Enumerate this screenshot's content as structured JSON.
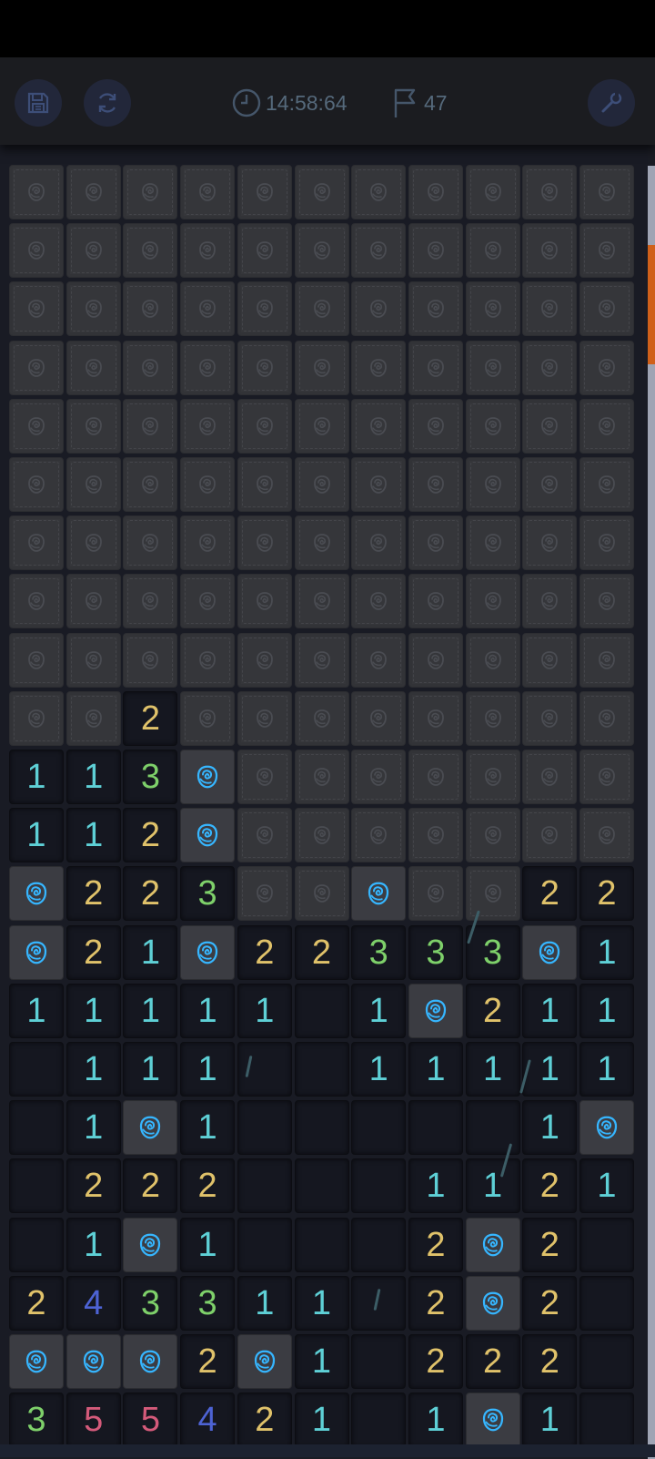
{
  "toolbar": {
    "timer": "14:58:64",
    "flags_remaining": "47",
    "icons": [
      "floppy-disk-icon",
      "refresh-icon",
      "clock-icon",
      "flag-icon",
      "wrench-icon"
    ]
  },
  "colors": {
    "1": "#5ed0d6",
    "2": "#e0c26a",
    "3": "#7ed06a",
    "4": "#4d63d4",
    "5": "#d45a7a",
    "rose_covered": "#4a4c52",
    "rose_flag": "#36b6ff"
  },
  "legend": {
    "C": "covered tile",
    "F": "flagged tile (rose)",
    "E": "revealed empty",
    "digit": "revealed number"
  },
  "board": {
    "cols": 11,
    "rows": [
      [
        "C",
        "C",
        "C",
        "C",
        "C",
        "C",
        "C",
        "C",
        "C",
        "C",
        "C"
      ],
      [
        "C",
        "C",
        "C",
        "C",
        "C",
        "C",
        "C",
        "C",
        "C",
        "C",
        "C"
      ],
      [
        "C",
        "C",
        "C",
        "C",
        "C",
        "C",
        "C",
        "C",
        "C",
        "C",
        "C"
      ],
      [
        "C",
        "C",
        "C",
        "C",
        "C",
        "C",
        "C",
        "C",
        "C",
        "C",
        "C"
      ],
      [
        "C",
        "C",
        "C",
        "C",
        "C",
        "C",
        "C",
        "C",
        "C",
        "C",
        "C"
      ],
      [
        "C",
        "C",
        "C",
        "C",
        "C",
        "C",
        "C",
        "C",
        "C",
        "C",
        "C"
      ],
      [
        "C",
        "C",
        "C",
        "C",
        "C",
        "C",
        "C",
        "C",
        "C",
        "C",
        "C"
      ],
      [
        "C",
        "C",
        "C",
        "C",
        "C",
        "C",
        "C",
        "C",
        "C",
        "C",
        "C"
      ],
      [
        "C",
        "C",
        "C",
        "C",
        "C",
        "C",
        "C",
        "C",
        "C",
        "C",
        "C"
      ],
      [
        "C",
        "C",
        "2",
        "C",
        "C",
        "C",
        "C",
        "C",
        "C",
        "C",
        "C"
      ],
      [
        "1",
        "1",
        "3",
        "F",
        "C",
        "C",
        "C",
        "C",
        "C",
        "C",
        "C"
      ],
      [
        "1",
        "1",
        "2",
        "F",
        "C",
        "C",
        "C",
        "C",
        "C",
        "C",
        "C"
      ],
      [
        "F",
        "2",
        "2",
        "3",
        "C",
        "C",
        "F",
        "C",
        "C",
        "2",
        "2"
      ],
      [
        "F",
        "2",
        "1",
        "F",
        "2",
        "2",
        "3",
        "3",
        "3",
        "F",
        "1"
      ],
      [
        "1",
        "1",
        "1",
        "1",
        "1",
        "E",
        "1",
        "F",
        "2",
        "1",
        "1"
      ],
      [
        "E",
        "1",
        "1",
        "1",
        "E",
        "E",
        "1",
        "1",
        "1",
        "1",
        "1"
      ],
      [
        "E",
        "1",
        "F",
        "1",
        "E",
        "E",
        "E",
        "E",
        "E",
        "1",
        "F"
      ],
      [
        "E",
        "2",
        "2",
        "2",
        "E",
        "E",
        "E",
        "1",
        "1",
        "2",
        "1"
      ],
      [
        "E",
        "1",
        "F",
        "1",
        "E",
        "E",
        "E",
        "2",
        "F",
        "2",
        "E"
      ],
      [
        "2",
        "4",
        "3",
        "3",
        "1",
        "1",
        "E",
        "2",
        "F",
        "2",
        "E"
      ],
      [
        "F",
        "F",
        "F",
        "2",
        "F",
        "1",
        "E",
        "2",
        "2",
        "2",
        "E"
      ],
      [
        "3",
        "5",
        "5",
        "4",
        "2",
        "1",
        "E",
        "1",
        "F",
        "1",
        "E"
      ]
    ]
  }
}
